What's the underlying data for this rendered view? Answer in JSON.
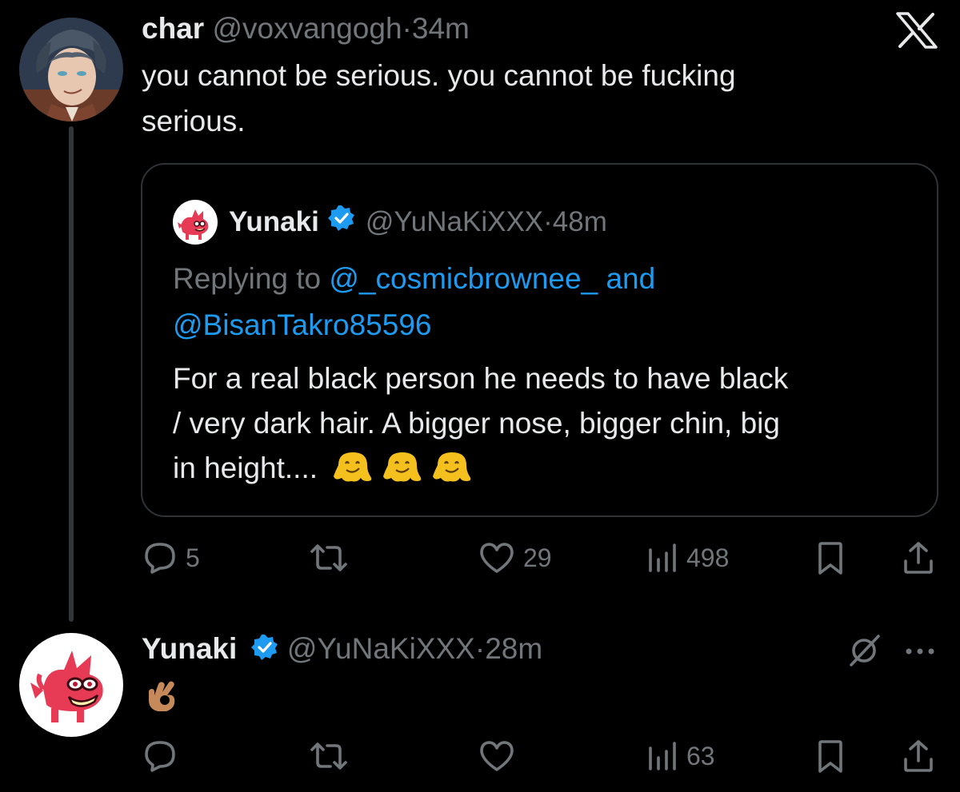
{
  "colors": {
    "background": "#000000",
    "text_primary": "#e7e9ea",
    "text_secondary": "#71767b",
    "link": "#1d9bf0",
    "verified": "#1d9bf0"
  },
  "top_bar": {
    "icon": "x-logo-icon"
  },
  "tweet": {
    "author_name": "char",
    "author_handle": "@voxvangogh",
    "separator": "·",
    "time": "34m",
    "text_line1": "you cannot be serious. you cannot be fucking",
    "text_line2": "serious.",
    "quote": {
      "author_name": "Yunaki",
      "author_handle": "@YuNaKiXXX",
      "separator": "·",
      "time": "48m",
      "replying_prefix": "Replying to",
      "mention1": "@_cosmicbrownee_",
      "mention_joiner": "and",
      "mention2": "@BisanTakro85596",
      "body_line1": "For a real black person he needs to have black",
      "body_line2": "/ very dark hair. A bigger nose, bigger chin, big",
      "body_line3": "in height....",
      "emojis": [
        "melting-face-emoji",
        "melting-face-emoji",
        "melting-face-emoji"
      ]
    },
    "actions": {
      "reply_count": "5",
      "retweet_count": "",
      "like_count": "29",
      "views_count": "498"
    }
  },
  "reply": {
    "author_name": "Yunaki",
    "author_handle": "@YuNaKiXXX",
    "separator": "·",
    "time": "28m",
    "text": "👌🏽",
    "actions": {
      "reply_count": "",
      "retweet_count": "",
      "like_count": "",
      "views_count": "63"
    }
  }
}
